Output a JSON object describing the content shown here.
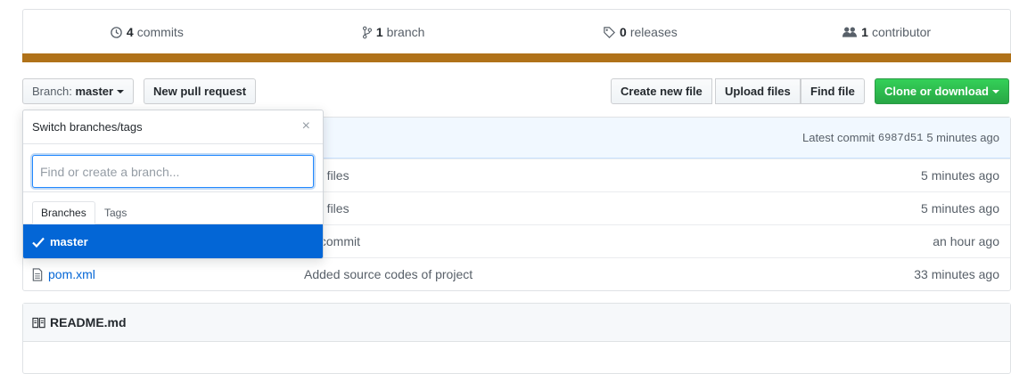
{
  "summary": {
    "commits": {
      "count": "4",
      "label": "commits",
      "icon": "history-icon"
    },
    "branches": {
      "count": "1",
      "label": "branch",
      "icon": "git-branch-icon"
    },
    "releases": {
      "count": "0",
      "label": "releases",
      "icon": "tag-icon"
    },
    "contributors": {
      "count": "1",
      "label": "contributor",
      "icon": "people-icon"
    },
    "language_color": "#b07219"
  },
  "toolbar": {
    "branch_prefix": "Branch:",
    "branch_name": "master",
    "new_pull_request": "New pull request",
    "create_new_file": "Create new file",
    "upload_files": "Upload files",
    "find_file": "Find file",
    "clone_or_download": "Clone or download"
  },
  "commit_bar": {
    "prefix": "Latest commit",
    "sha": "6987d51",
    "age": "5 minutes ago"
  },
  "files": [
    {
      "name": "",
      "message": "dify files",
      "age": "5 minutes ago"
    },
    {
      "name": "",
      "message": "dify files",
      "age": "5 minutes ago"
    },
    {
      "name": "",
      "message": "ial commit",
      "age": "an hour ago"
    },
    {
      "name": "pom.xml",
      "message": "Added source codes of project",
      "age": "33 minutes ago",
      "icon": "file-icon"
    }
  ],
  "readme": {
    "title": "README.md",
    "icon": "book-icon"
  },
  "branch_dropdown": {
    "title": "Switch branches/tags",
    "close": "×",
    "placeholder": "Find or create a branch...",
    "tabs": [
      "Branches",
      "Tags"
    ],
    "items": [
      {
        "name": "master",
        "selected": true
      }
    ]
  },
  "colors": {
    "accent": "#0366d6",
    "green": "#28a745",
    "commit_bar_bg": "#f1f8ff"
  }
}
